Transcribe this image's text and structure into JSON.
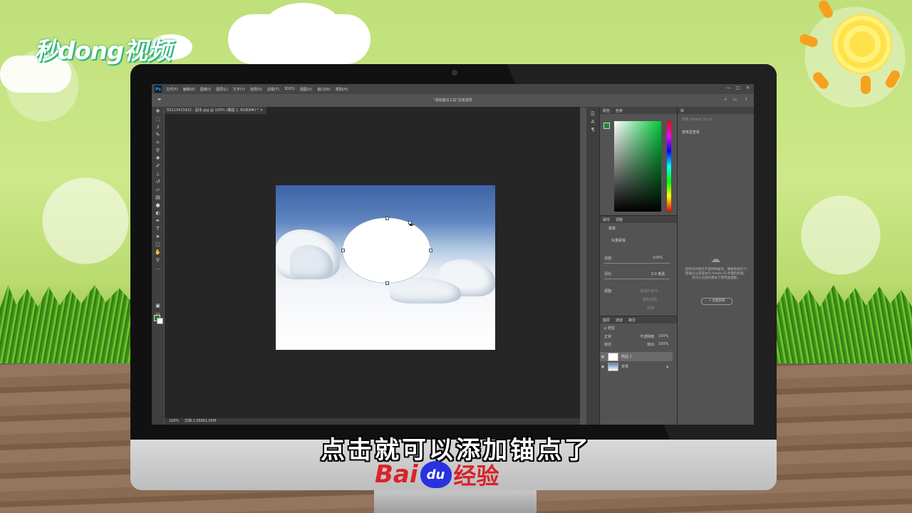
{
  "branding": {
    "top_logo": "秒dong视频",
    "baidu_bai": "Bai",
    "baidu_du": "du",
    "baidu_jingyan": "经验"
  },
  "subtitle": "点击就可以添加锚点了",
  "photoshop": {
    "menu": [
      "文件(F)",
      "编辑(E)",
      "图像(I)",
      "图层(L)",
      "文字(Y)",
      "选择(S)",
      "滤镜(T)",
      "3D(D)",
      "视图(V)",
      "窗口(W)",
      "帮助(H)"
    ],
    "window_controls": [
      "—",
      "□",
      "✕"
    ],
    "option_bar_text": "\"添加锚点工具\"没有选项",
    "doc_tab": "55213423922 - 副本.jpg @ 100% (椭圆 1, RGB/8#) *",
    "status_zoom": "100%",
    "status_doc": "文档:1.05M/1.05M",
    "color_panel": {
      "tabs": [
        "颜色",
        "色板"
      ]
    },
    "properties_panel": {
      "tabs": [
        "属性",
        "调整"
      ],
      "type_label": "蒙版",
      "mask_label": "矢量蒙版",
      "density_label": "浓度:",
      "density_value": "100%",
      "feather_label": "羽化:",
      "feather_value": "0.0 像素",
      "adjust_label": "调整:",
      "select_and_mask_btn": "选择并遮住...",
      "color_range_btn": "颜色范围...",
      "invert_btn": "反相"
    },
    "layers_panel": {
      "tabs": [
        "图层",
        "通道",
        "路径"
      ],
      "filter_label": "ρ 类型",
      "blend_mode": "正常",
      "opacity_label": "不透明度:",
      "opacity_value": "100%",
      "lock_label": "锁定:",
      "fill_label": "填充:",
      "fill_value": "100%",
      "layers": [
        {
          "name": "椭圆 1",
          "active": true
        },
        {
          "name": "背景",
          "active": false
        }
      ]
    },
    "library_panel": {
      "tab": "库",
      "search_placeholder": "搜索 Adobe Stock",
      "filter_label": "按类型查看",
      "message": "您所在的地区不提供库服务。请联系您的 IT 管理员以获取访问 Adobe ID 所需的权限。您可以在脱机模式下使用此面板。",
      "create_button": "+ 创建新库"
    }
  }
}
